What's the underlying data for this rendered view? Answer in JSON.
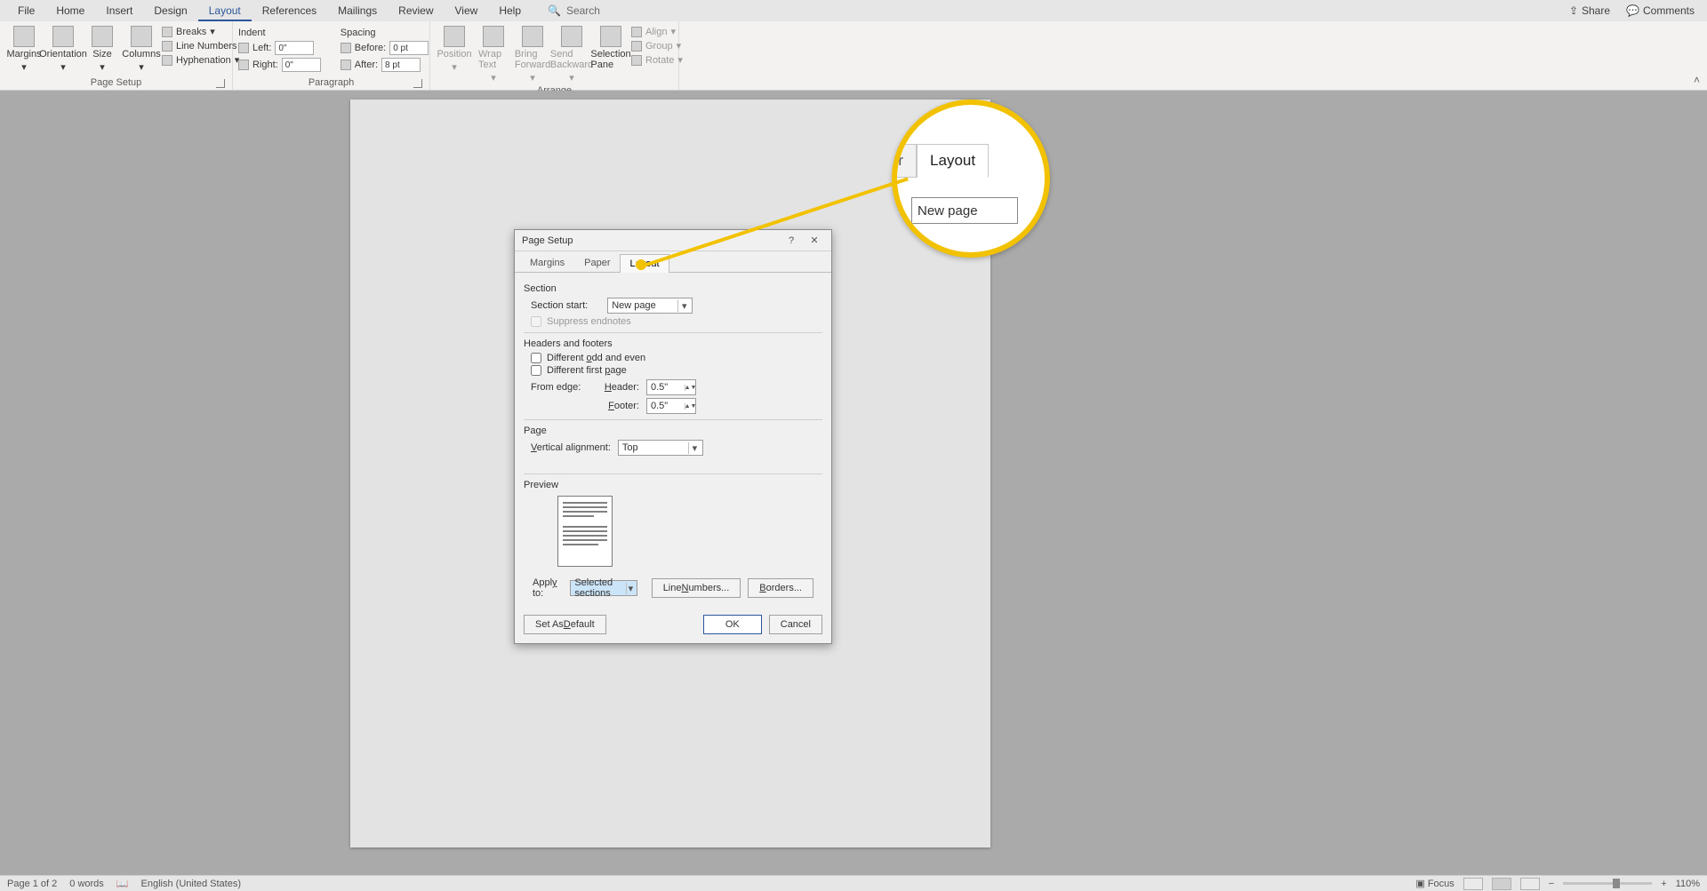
{
  "menu": {
    "file": "File",
    "home": "Home",
    "insert": "Insert",
    "design": "Design",
    "layout": "Layout",
    "references": "References",
    "mailings": "Mailings",
    "review": "Review",
    "view": "View",
    "help": "Help",
    "search": "Search"
  },
  "topright": {
    "share": "Share",
    "comments": "Comments"
  },
  "ribbon": {
    "page_setup": {
      "margins": "Margins",
      "orientation": "Orientation",
      "size": "Size",
      "columns": "Columns",
      "breaks": "Breaks",
      "line_numbers": "Line Numbers",
      "hyphenation": "Hyphenation",
      "group": "Page Setup"
    },
    "paragraph": {
      "indent": "Indent",
      "spacing": "Spacing",
      "left": "Left:",
      "right": "Right:",
      "before": "Before:",
      "after": "After:",
      "left_v": "0\"",
      "right_v": "0\"",
      "before_v": "0 pt",
      "after_v": "8 pt",
      "group": "Paragraph"
    },
    "arrange": {
      "position": "Position",
      "wrap": "Wrap Text",
      "bring": "Bring Forward",
      "send": "Send Backward",
      "selection": "Selection Pane",
      "align": "Align",
      "group_btn": "Group",
      "rotate": "Rotate",
      "group": "Arrange"
    }
  },
  "dialog": {
    "title": "Page Setup",
    "tabs": {
      "margins": "Margins",
      "paper": "Paper",
      "layout": "Layout"
    },
    "section": {
      "head": "Section",
      "start_lbl": "Section start:",
      "start_v": "New page",
      "suppress": "Suppress endnotes"
    },
    "hf": {
      "head": "Headers and footers",
      "odd_even": "Different odd and even",
      "first": "Different first page",
      "from_edge": "From edge:",
      "header_lbl": "Header:",
      "header_v": "0.5\"",
      "footer_lbl": "Footer:",
      "footer_v": "0.5\""
    },
    "page": {
      "head": "Page",
      "valign_lbl": "Vertical alignment:",
      "valign_v": "Top"
    },
    "preview": "Preview",
    "apply_lbl": "Apply to:",
    "apply_v": "Selected sections",
    "linenums": "Line Numbers...",
    "borders": "Borders...",
    "setdefault": "Set As Default",
    "ok": "OK",
    "cancel": "Cancel",
    "help": "?",
    "close": "✕"
  },
  "callout": {
    "paper": "aper",
    "layout": "Layout",
    "newpage": "New page"
  },
  "status": {
    "page": "Page 1 of 2",
    "words": "0 words",
    "lang": "English (United States)",
    "focus": "Focus",
    "zoom": "110%"
  }
}
